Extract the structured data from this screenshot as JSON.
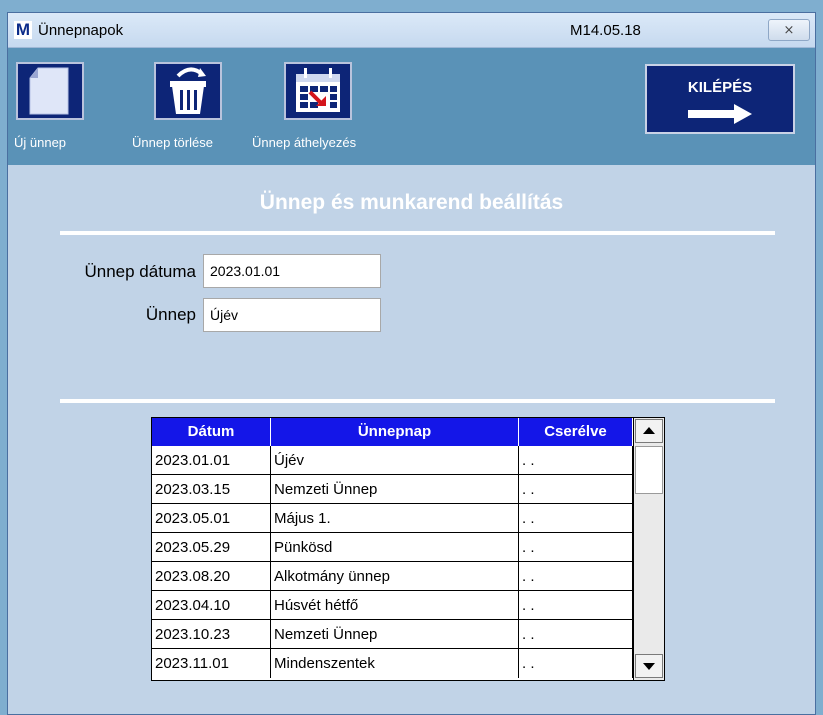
{
  "window": {
    "app_letter": "M",
    "title": "Ünnepnapok",
    "version": "M14.05.18",
    "close_symbol": "⨯"
  },
  "toolbar": {
    "new_label": "Új ünnep",
    "delete_label": "Ünnep törlése",
    "move_label": "Ünnep áthelyezés",
    "exit_label": "KILÉPÉS"
  },
  "heading": "Ünnep és munkarend beállítás",
  "form": {
    "date_label": "Ünnep dátuma",
    "date_value": "2023.01.01",
    "holiday_label": "Ünnep",
    "holiday_value": "Újév"
  },
  "table": {
    "columns": [
      "Dátum",
      "Ünnepnap",
      "Cserélve"
    ],
    "rows": [
      {
        "date": "2023.01.01",
        "name": "Újév",
        "swapped": ". ."
      },
      {
        "date": "2023.03.15",
        "name": "Nemzeti Ünnep",
        "swapped": ". ."
      },
      {
        "date": "2023.05.01",
        "name": "Május 1.",
        "swapped": ". ."
      },
      {
        "date": "2023.05.29",
        "name": "Pünkösd",
        "swapped": ". ."
      },
      {
        "date": "2023.08.20",
        "name": "Alkotmány ünnep",
        "swapped": ". ."
      },
      {
        "date": "2023.04.10",
        "name": "Húsvét hétfő",
        "swapped": ". ."
      },
      {
        "date": "2023.10.23",
        "name": "Nemzeti Ünnep",
        "swapped": ". ."
      },
      {
        "date": "2023.11.01",
        "name": "Mindenszentek",
        "swapped": ". ."
      }
    ]
  },
  "colors": {
    "toolbar": "#5a92b7",
    "panel": "#c1d3e7",
    "icon_bg": "#0d2577",
    "header_bg": "#1416e8"
  }
}
